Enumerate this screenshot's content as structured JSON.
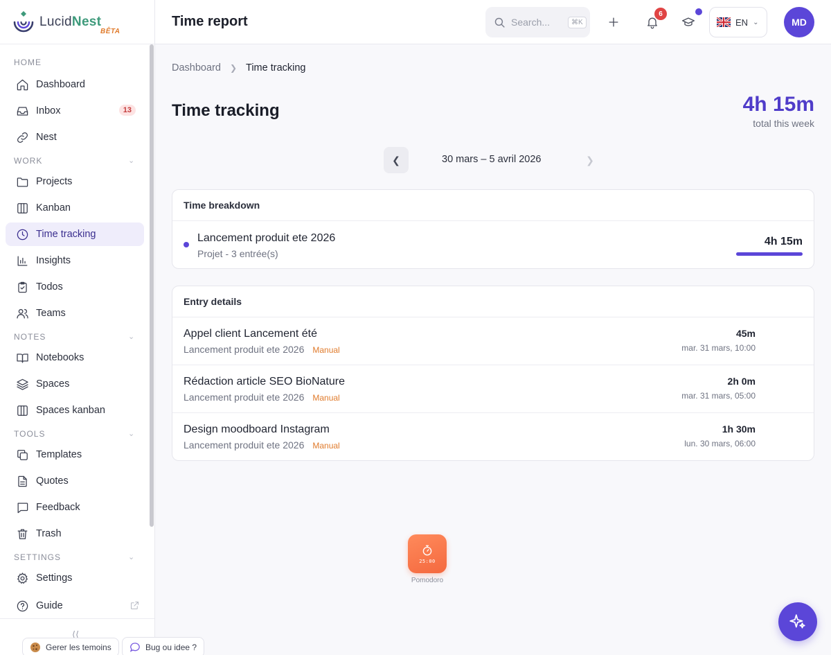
{
  "brand": {
    "name_a": "Lucid",
    "name_b": "Nest",
    "badge": "BÊTA"
  },
  "sidebar": {
    "sections": [
      {
        "label": "HOME"
      },
      {
        "label": "WORK"
      },
      {
        "label": "NOTES"
      },
      {
        "label": "TOOLS"
      },
      {
        "label": "SETTINGS"
      }
    ],
    "items": [
      {
        "label": "Dashboard",
        "icon": "home-icon"
      },
      {
        "label": "Inbox",
        "icon": "inbox-icon",
        "badge": "13"
      },
      {
        "label": "Nest",
        "icon": "link-icon"
      },
      {
        "label": "Projects",
        "icon": "folder-icon"
      },
      {
        "label": "Kanban",
        "icon": "kanban-icon"
      },
      {
        "label": "Time tracking",
        "icon": "clock-icon",
        "active": true
      },
      {
        "label": "Insights",
        "icon": "bar-chart-icon"
      },
      {
        "label": "Todos",
        "icon": "clipboard-check-icon"
      },
      {
        "label": "Teams",
        "icon": "users-icon"
      },
      {
        "label": "Notebooks",
        "icon": "book-open-icon"
      },
      {
        "label": "Spaces",
        "icon": "layers-icon"
      },
      {
        "label": "Spaces kanban",
        "icon": "kanban-icon"
      },
      {
        "label": "Templates",
        "icon": "copy-icon"
      },
      {
        "label": "Quotes",
        "icon": "file-text-icon"
      },
      {
        "label": "Feedback",
        "icon": "message-square-icon"
      },
      {
        "label": "Trash",
        "icon": "trash-icon"
      },
      {
        "label": "Settings",
        "icon": "gear-icon"
      },
      {
        "label": "Guide",
        "icon": "help-circle-icon"
      }
    ],
    "footer": {
      "cookies_label": "Gerer les temoins",
      "bug_label": "Bug ou idee ?"
    }
  },
  "header": {
    "title": "Time report",
    "search_placeholder": "Search...",
    "search_shortcut": "⌘K",
    "notifications_count": "6",
    "language": "EN",
    "avatar_initials": "MD"
  },
  "main": {
    "breadcrumb": [
      "Dashboard",
      "Time tracking"
    ],
    "title": "Time tracking",
    "total_value": "4h 15m",
    "total_label": "total this week",
    "week_label": "30 mars – 5 avril 2026",
    "breakdown": {
      "heading": "Time breakdown",
      "rows": [
        {
          "name": "Lancement produit ete 2026",
          "sub": "Projet - 3 entrée(s)",
          "time": "4h 15m",
          "share": 1.0
        }
      ]
    },
    "entries": {
      "heading": "Entry details",
      "rows": [
        {
          "title": "Appel client Lancement été",
          "project": "Lancement produit ete 2026",
          "tag": "Manual",
          "duration": "45m",
          "date": "mar. 31 mars, 10:00"
        },
        {
          "title": "Rédaction article SEO BioNature",
          "project": "Lancement produit ete 2026",
          "tag": "Manual",
          "duration": "2h 0m",
          "date": "mar. 31 mars, 05:00"
        },
        {
          "title": "Design moodboard Instagram",
          "project": "Lancement produit ete 2026",
          "tag": "Manual",
          "duration": "1h 30m",
          "date": "lun. 30 mars, 06:00"
        }
      ]
    }
  },
  "pomodoro": {
    "time": "25:00",
    "label": "Pomodoro"
  },
  "colors": {
    "accent": "#5b46d8",
    "brand_green": "#3e9a7b",
    "tag_orange": "#e07b2c",
    "pomodoro": "#f4693f"
  }
}
